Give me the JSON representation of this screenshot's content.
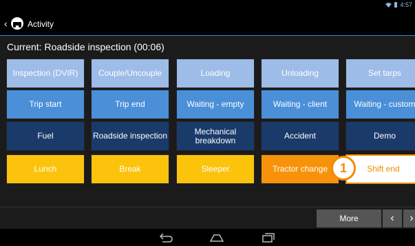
{
  "status": {
    "time": "4:57"
  },
  "app": {
    "title": "Activity"
  },
  "current": {
    "text": "Current: Roadside inspection (00:06)"
  },
  "grid": {
    "rows": [
      [
        {
          "label": "Inspection (DVIR)",
          "color": "#9dbce8"
        },
        {
          "label": "Couple/Uncouple",
          "color": "#9dbce8"
        },
        {
          "label": "Loading",
          "color": "#9dbce8"
        },
        {
          "label": "Unloading",
          "color": "#9dbce8"
        },
        {
          "label": "Set tarps",
          "color": "#9dbce8"
        }
      ],
      [
        {
          "label": "Trip start",
          "color": "#4a8fd8"
        },
        {
          "label": "Trip end",
          "color": "#4a8fd8"
        },
        {
          "label": "Waiting - empty",
          "color": "#4a8fd8"
        },
        {
          "label": "Waiting - client",
          "color": "#4a8fd8"
        },
        {
          "label": "Waiting - custom",
          "color": "#4a8fd8"
        }
      ],
      [
        {
          "label": "Fuel",
          "color": "#1a3a6a"
        },
        {
          "label": "Roadside inspection",
          "color": "#1a3a6a"
        },
        {
          "label": "Mechanical breakdown",
          "color": "#1a3a6a"
        },
        {
          "label": "Accident",
          "color": "#1a3a6a"
        },
        {
          "label": "Demo",
          "color": "#1a3a6a"
        }
      ],
      [
        {
          "label": "Lunch",
          "color": "#fcc30c"
        },
        {
          "label": "Break",
          "color": "#fcc30c"
        },
        {
          "label": "Sleeper",
          "color": "#fcc30c"
        },
        {
          "label": "Tractor change",
          "color": "#f7930a"
        },
        {
          "label": "Shift end",
          "color": "#ffffff"
        }
      ]
    ]
  },
  "badge": {
    "number": "1",
    "color": "#f28a00"
  },
  "footer": {
    "more_label": "More",
    "prev_icon": "chevron-left-icon",
    "next_icon": "chevron-right-icon"
  }
}
